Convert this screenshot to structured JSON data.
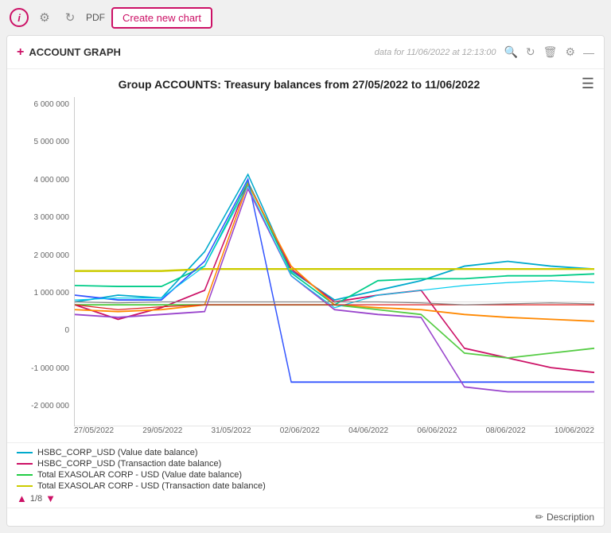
{
  "toolbar": {
    "info_label": "i",
    "pdf_label": "PDF",
    "create_chart_label": "Create new chart"
  },
  "panel": {
    "title": "ACCOUNT GRAPH",
    "data_info": "data for 11/06/2022 at 12:13:00"
  },
  "chart": {
    "title": "Group ACCOUNTS: Treasury balances from 27/05/2022 to 11/06/2022",
    "y_labels": [
      "6 000 000",
      "5 000 000",
      "4 000 000",
      "3 000 000",
      "2 000 000",
      "1 000 000",
      "0",
      "-1 000 000",
      "-2 000 000"
    ],
    "x_labels": [
      "27/05/2022",
      "29/05/2022",
      "31/05/2022",
      "02/06/2022",
      "04/06/2022",
      "06/06/2022",
      "08/06/2022",
      "10/06/2022"
    ]
  },
  "legend": {
    "items": [
      {
        "label": "HSBC_CORP_USD (Value date balance)",
        "color": "#00aacc"
      },
      {
        "label": "HSBC_CORP_USD (Transaction date balance)",
        "color": "#cc1166"
      },
      {
        "label": "Total EXASOLAR CORP - USD (Value date balance)",
        "color": "#22cc44"
      },
      {
        "label": "Total EXASOLAR CORP - USD (Transaction date balance)",
        "color": "#cccc00"
      }
    ],
    "nav_text": "1/8"
  },
  "description": {
    "label": "Description",
    "icon": "pencil"
  }
}
